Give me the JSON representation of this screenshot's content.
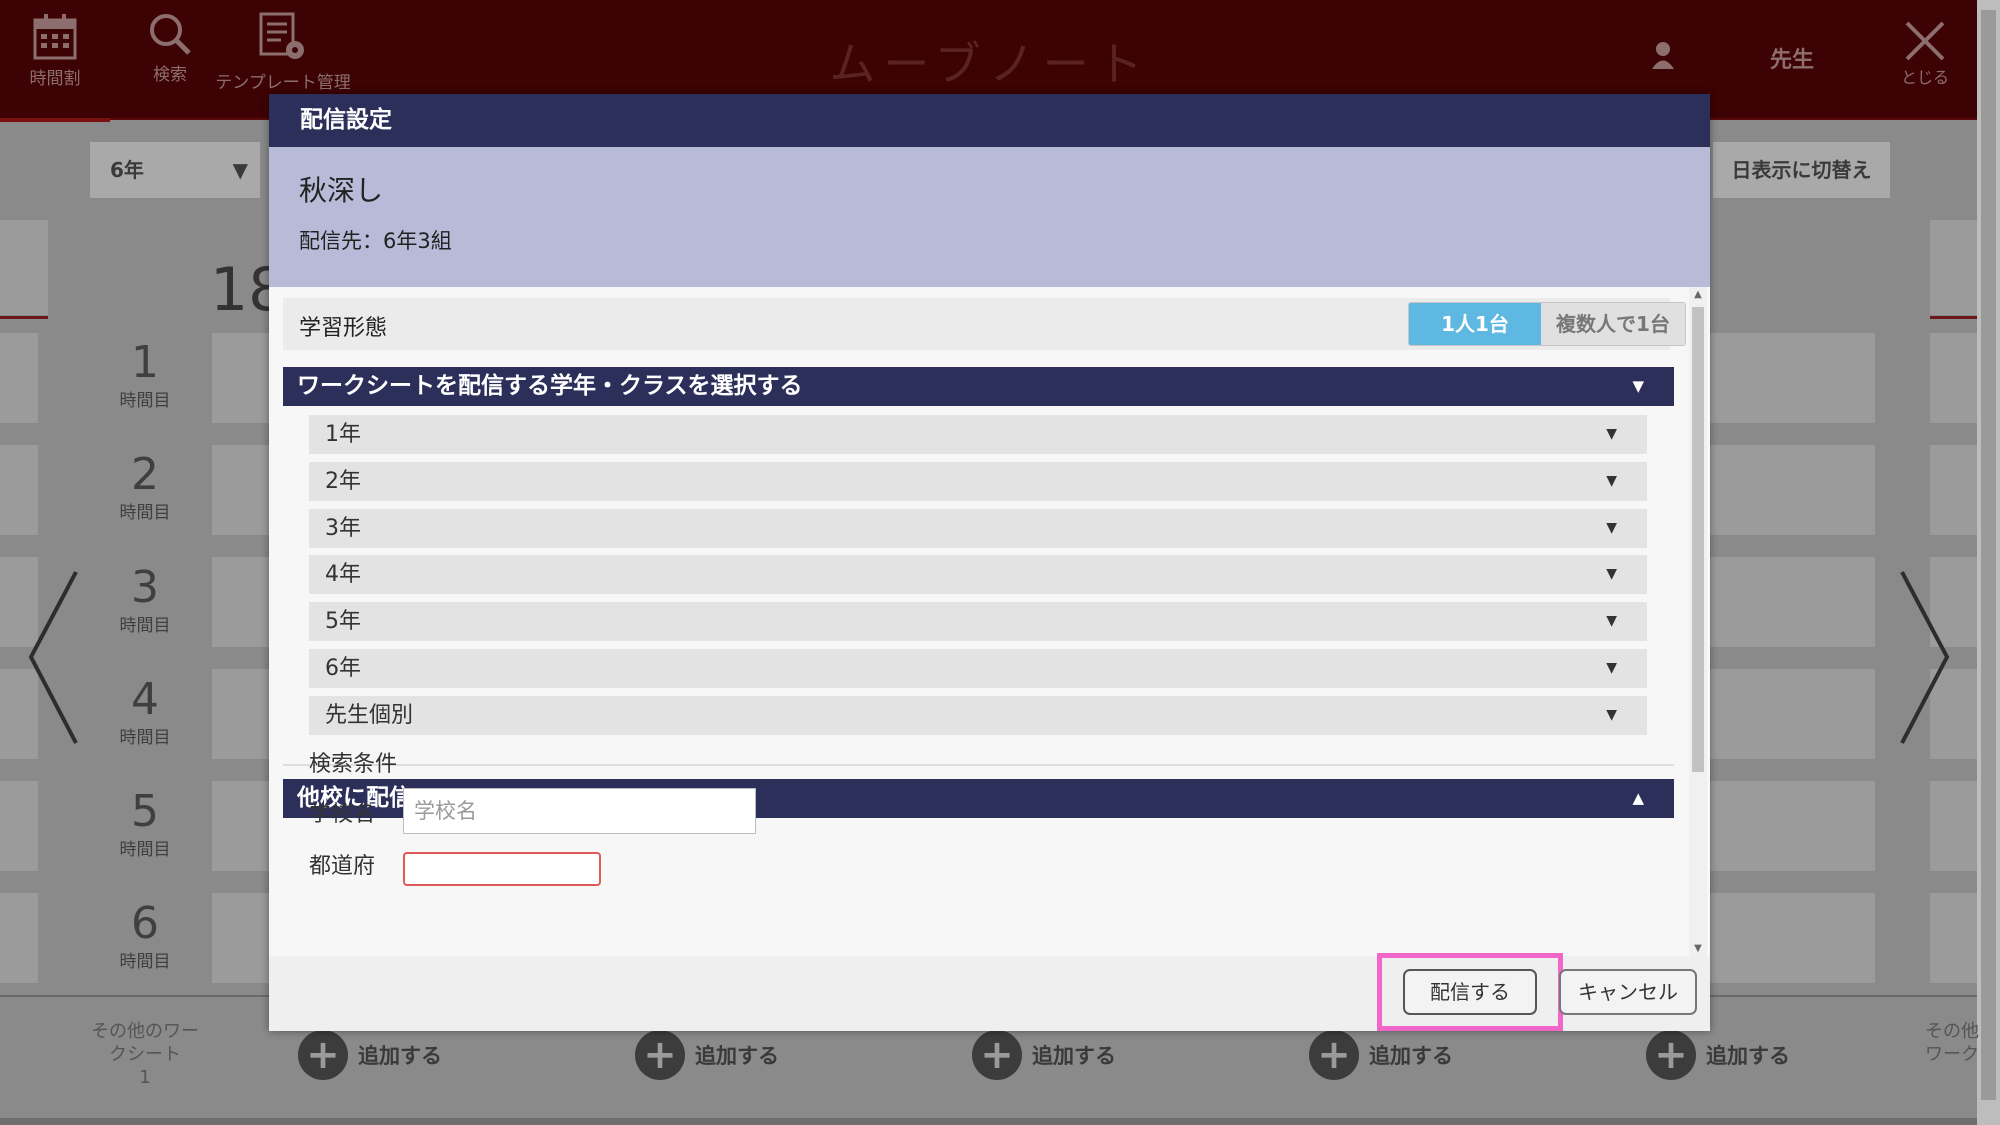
{
  "app": {
    "title": "ムーブノート",
    "toolbar": [
      {
        "label": "時間割",
        "icon": "calendar-icon"
      },
      {
        "label": "検索",
        "icon": "search-icon"
      },
      {
        "label": "テンプレート管理",
        "icon": "template-gear-icon"
      }
    ],
    "user": {
      "name": "先生",
      "icon": "user-icon"
    },
    "close_label": "とじる"
  },
  "background": {
    "grade_select": "6年",
    "day_switch": "日表示に切替え",
    "date": "18",
    "periods": [
      {
        "num": "1",
        "sub": "時間目"
      },
      {
        "num": "2",
        "sub": "時間目"
      },
      {
        "num": "3",
        "sub": "時間目"
      },
      {
        "num": "4",
        "sub": "時間目"
      },
      {
        "num": "5",
        "sub": "時間目"
      },
      {
        "num": "6",
        "sub": "時間目"
      }
    ],
    "other_worksheet": "その他のワークシート",
    "other_worksheet_count": "1",
    "other_worksheet_right": "その他ワーク",
    "add_label": "追加する"
  },
  "modal": {
    "header": "配信設定",
    "worksheet_title": "秋深し",
    "destination": "配信先：6年3組",
    "learning_style": {
      "label": "学習形態",
      "options": [
        "1人1台",
        "複数人で1台"
      ],
      "selected": "1人1台"
    },
    "class_section": {
      "title": "ワークシートを配信する学年・クラスを選択する",
      "grades": [
        "1年",
        "2年",
        "3年",
        "4年",
        "5年",
        "6年",
        "先生個別"
      ]
    },
    "other_school": {
      "title": "他校に配信",
      "search_label": "検索条件",
      "school_label": "学校名",
      "school_placeholder": "学校名",
      "pref_label": "都道府"
    },
    "buttons": {
      "send": "配信する",
      "cancel": "キャンセル"
    },
    "highlight_color": "#f067c9",
    "accent": "#2c2f5a",
    "toggle_on_color": "#5fb8e1"
  }
}
